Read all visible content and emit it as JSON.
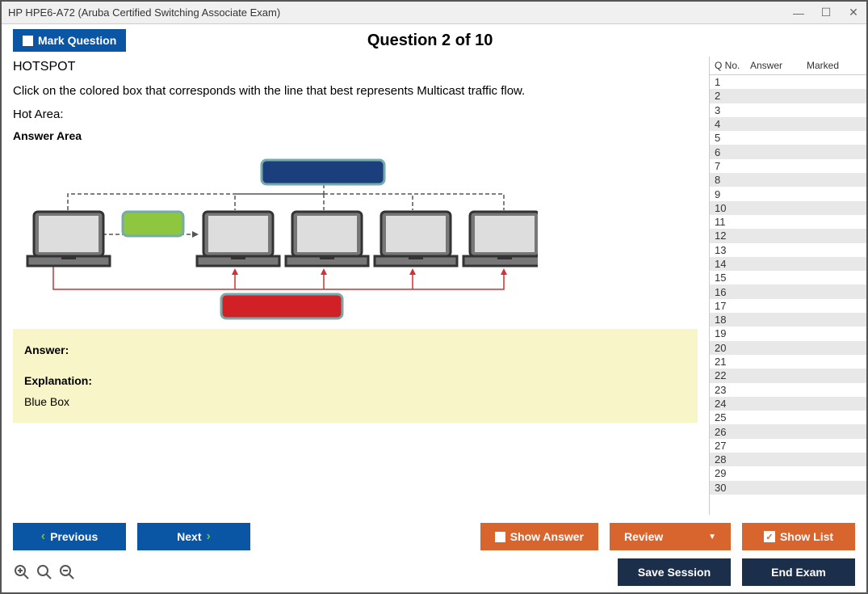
{
  "window": {
    "title": "HP HPE6-A72 (Aruba Certified Switching Associate Exam)"
  },
  "header": {
    "mark_label": "Mark Question",
    "question_title": "Question 2 of 10"
  },
  "question": {
    "type_label": "HOTSPOT",
    "text": "Click on the colored box that corresponds with the line that best represents Multicast traffic flow.",
    "hot_area_label": "Hot Area:",
    "answer_area_label": "Answer Area"
  },
  "answer_block": {
    "answer_label": "Answer:",
    "explanation_label": "Explanation:",
    "explanation_text": "Blue Box"
  },
  "list": {
    "col_qno": "Q No.",
    "col_answer": "Answer",
    "col_marked": "Marked",
    "rows": [
      {
        "n": "1"
      },
      {
        "n": "2"
      },
      {
        "n": "3"
      },
      {
        "n": "4"
      },
      {
        "n": "5"
      },
      {
        "n": "6"
      },
      {
        "n": "7"
      },
      {
        "n": "8"
      },
      {
        "n": "9"
      },
      {
        "n": "10"
      },
      {
        "n": "11"
      },
      {
        "n": "12"
      },
      {
        "n": "13"
      },
      {
        "n": "14"
      },
      {
        "n": "15"
      },
      {
        "n": "16"
      },
      {
        "n": "17"
      },
      {
        "n": "18"
      },
      {
        "n": "19"
      },
      {
        "n": "20"
      },
      {
        "n": "21"
      },
      {
        "n": "22"
      },
      {
        "n": "23"
      },
      {
        "n": "24"
      },
      {
        "n": "25"
      },
      {
        "n": "26"
      },
      {
        "n": "27"
      },
      {
        "n": "28"
      },
      {
        "n": "29"
      },
      {
        "n": "30"
      }
    ],
    "selected_index": 1
  },
  "buttons": {
    "previous": "Previous",
    "next": "Next",
    "show_answer": "Show Answer",
    "review": "Review",
    "show_list": "Show List",
    "save_session": "Save Session",
    "end_exam": "End Exam"
  },
  "diagram": {
    "boxes": {
      "blue": "#1b3f7c",
      "green": "#8fc63f",
      "red": "#d22027"
    }
  }
}
